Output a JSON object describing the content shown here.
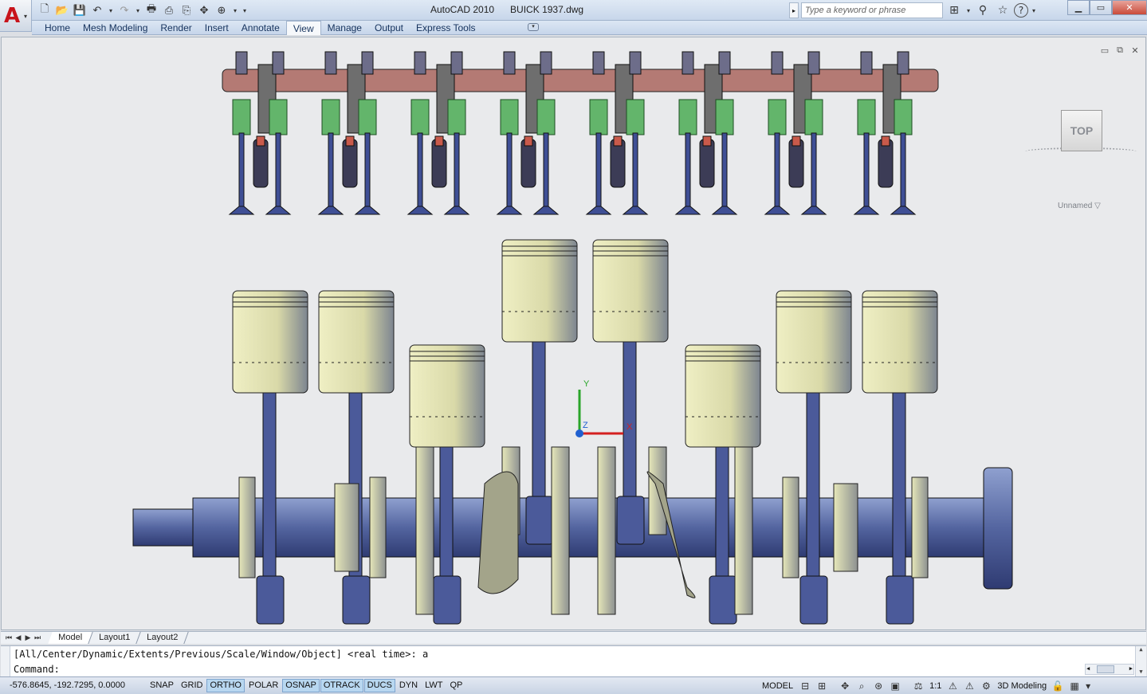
{
  "app": {
    "title": "AutoCAD 2010      BUICK 1937.dwg",
    "logo_glyph": "A",
    "menu_arrow": "▾"
  },
  "qat": {
    "icons": [
      "new-icon",
      "open-icon",
      "save-icon",
      "undo-icon",
      "redo-icon",
      "plot-icon",
      "plot-preview-icon",
      "publish-icon",
      "pan-icon",
      "orbit-icon",
      "workspace-icon"
    ],
    "new": "🗋",
    "open": "📂",
    "save": "💾",
    "undo": "↶",
    "undo_drop": "▾",
    "redo": "↷",
    "redo_drop": "▾",
    "plot": "🖶",
    "preview": "⎙",
    "publish": "⎘",
    "pan": "✥",
    "orbit": "⊕",
    "orbit_drop": "▾",
    "customize": "▾"
  },
  "infocenter": {
    "expand": "▸",
    "search_placeholder": "Type a keyword or phrase",
    "binoculars": "⊞",
    "binoc_drop": "▾",
    "comm": "⚲",
    "favorites": "☆",
    "help": "?",
    "help_drop": "▾"
  },
  "window": {
    "minimize": "▁",
    "restore": "▭",
    "close": "✕"
  },
  "ribbon": {
    "tabs": [
      "Home",
      "Mesh Modeling",
      "Render",
      "Insert",
      "Annotate",
      "View",
      "Manage",
      "Output",
      "Express Tools"
    ],
    "active_tab": "View",
    "minimize_glyph": "▾"
  },
  "viewport": {
    "background": "#e9eaec",
    "controls": {
      "minimize": "▭",
      "restore": "⧉",
      "close": "✕"
    },
    "viewcube_face": "TOP",
    "ucs_name": "Unnamed ▽",
    "ucs_axes": {
      "x": "X",
      "y": "Y",
      "z": "Z"
    },
    "colors": {
      "valve_stem": "#3f4f95",
      "spring": "#63b56b",
      "rocker_shaft": "#b47a74",
      "piston": "#d9d9a8",
      "rod": "#4b5a9a",
      "crank_web": "#cacb9b",
      "crank_shaft": "#5465a0",
      "axis_x": "#d42020",
      "axis_y": "#2aa52a",
      "axis_z": "#2060d0"
    },
    "drawing": {
      "cylinders": 8,
      "piston_heights": [
        "high",
        "high",
        "low",
        "top",
        "top",
        "low",
        "high",
        "high"
      ]
    }
  },
  "layout_tabs": {
    "nav": [
      "⏮",
      "◀",
      "▶",
      "⏭"
    ],
    "tabs": [
      "Model",
      "Layout1",
      "Layout2"
    ],
    "active": "Model"
  },
  "command": {
    "history": "[All/Center/Dynamic/Extents/Previous/Scale/Window/Object] <real time>: a",
    "prompt": "Command:",
    "value": "",
    "scroll_up": "▲",
    "scroll_down": "▼",
    "hscroll_left": "◀",
    "hscroll_right": "▶"
  },
  "status": {
    "coordinates": "-576.8645, -192.7295, 0.0000",
    "toggles": [
      {
        "label": "SNAP",
        "on": false
      },
      {
        "label": "GRID",
        "on": false
      },
      {
        "label": "ORTHO",
        "on": true
      },
      {
        "label": "POLAR",
        "on": false
      },
      {
        "label": "OSNAP",
        "on": true
      },
      {
        "label": "OTRACK",
        "on": true
      },
      {
        "label": "DUCS",
        "on": true
      },
      {
        "label": "DYN",
        "on": false
      },
      {
        "label": "LWT",
        "on": false
      },
      {
        "label": "QP",
        "on": false
      }
    ],
    "model": "MODEL",
    "scale": "1:1",
    "workspace": "3D Modeling",
    "icons": {
      "model_viewports": "⊟",
      "layout_viewports": "⊞",
      "pan": "✥",
      "zoom": "⌕",
      "steering": "⊛",
      "showmotion": "▣",
      "annotation_scale": "⚖",
      "annotation_visibility": "⚠",
      "autoscale": "⚠",
      "workspace": "⚙",
      "lock": "🔓",
      "clean": "▦",
      "menu": "▾"
    }
  }
}
